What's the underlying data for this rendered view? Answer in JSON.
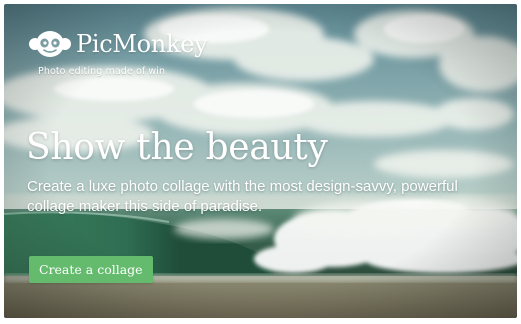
{
  "brand": {
    "name": "PicMonkey",
    "tagline": "Photo editing made of win",
    "logo_icon": "monkey-face-icon"
  },
  "hero": {
    "headline": "Show the beauty",
    "description": "Create a luxe photo collage with the most design-savvy, powerful collage maker this side of paradise.",
    "cta_label": "Create a collage",
    "background": "ocean-wave-photo"
  },
  "colors": {
    "cta": "#64bb6d",
    "text": "#ffffff"
  }
}
